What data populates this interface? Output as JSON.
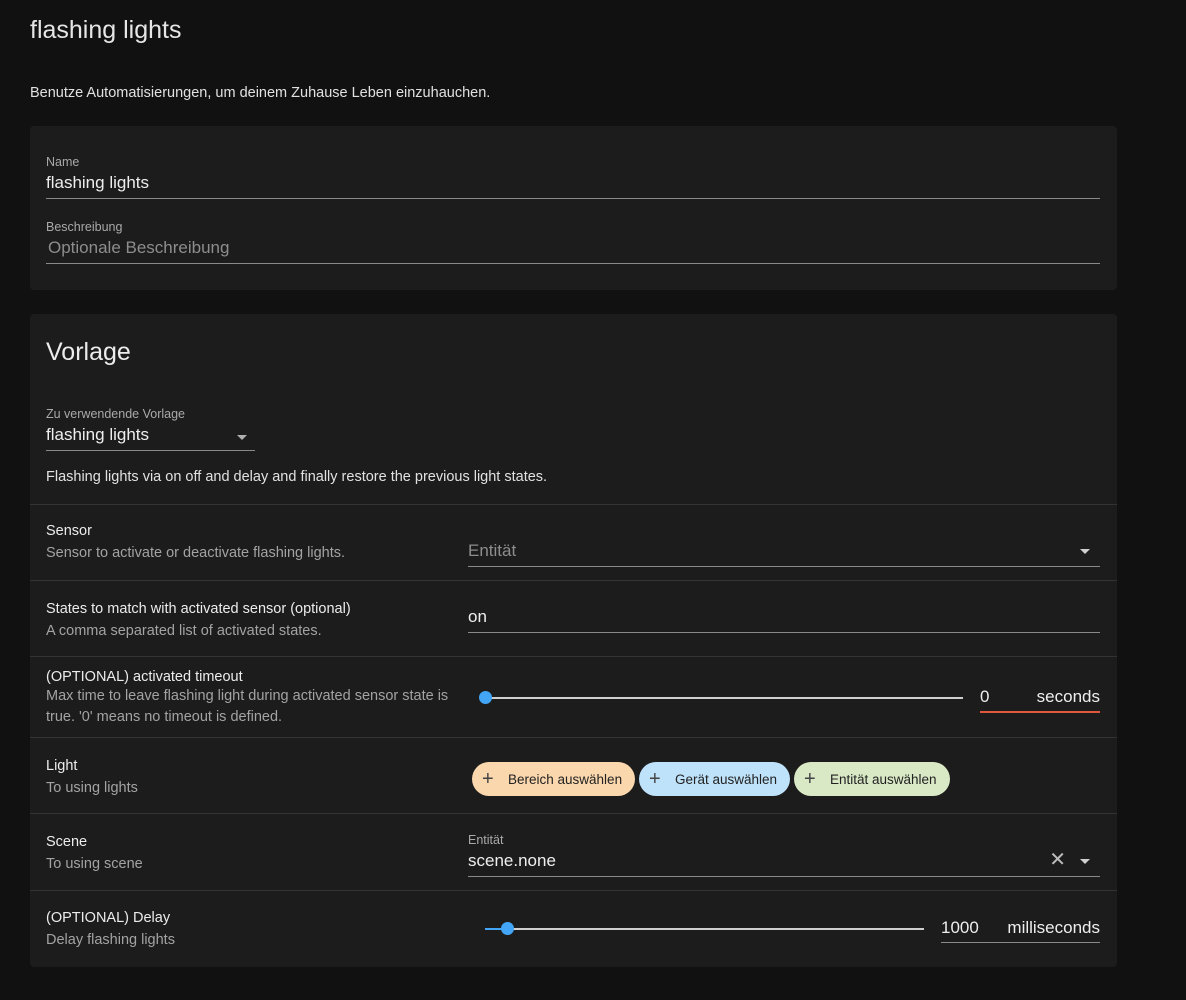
{
  "page": {
    "title": "flashing lights",
    "intro": "Benutze Automatisierungen, um deinem Zuhause Leben einzuhauchen."
  },
  "info": {
    "name_label": "Name",
    "name_value": "flashing lights",
    "desc_label": "Beschreibung",
    "desc_placeholder": "Optionale Beschreibung"
  },
  "blueprint": {
    "section_title": "Vorlage",
    "select_label": "Zu verwendende Vorlage",
    "select_value": "flashing lights",
    "description": "Flashing lights via on off and delay and finally restore the previous light states."
  },
  "rows": {
    "sensor": {
      "title": "Sensor",
      "subtitle": "Sensor to activate or deactivate flashing lights.",
      "placeholder": "Entität"
    },
    "states": {
      "title": "States to match with activated sensor (optional)",
      "subtitle": "A comma separated list of activated states.",
      "value": "on"
    },
    "timeout": {
      "title": "(OPTIONAL) activated timeout",
      "subtitle": "Max time to leave flashing light during activated sensor state is true. '0' means no timeout is defined.",
      "value": "0",
      "unit": "seconds",
      "slider_fraction": 0.0
    },
    "light": {
      "title": "Light",
      "subtitle": "To using lights",
      "chips": [
        "Bereich auswählen",
        "Gerät auswählen",
        "Entität auswählen"
      ]
    },
    "scene": {
      "title": "Scene",
      "subtitle": "To using scene",
      "label": "Entität",
      "value": "scene.none"
    },
    "delay": {
      "title": "(OPTIONAL) Delay",
      "subtitle": "Delay flashing lights",
      "value": "1000",
      "unit": "milliseconds",
      "slider_fraction": 0.05
    }
  },
  "colors": {
    "accent": "#42a5f5",
    "error_underline": "#e0573f",
    "chip_area": "#fbd7ad",
    "chip_device": "#bfe2fb",
    "chip_entity": "#d9e9c6"
  },
  "icons": {
    "plus": "+",
    "close": "✕"
  }
}
